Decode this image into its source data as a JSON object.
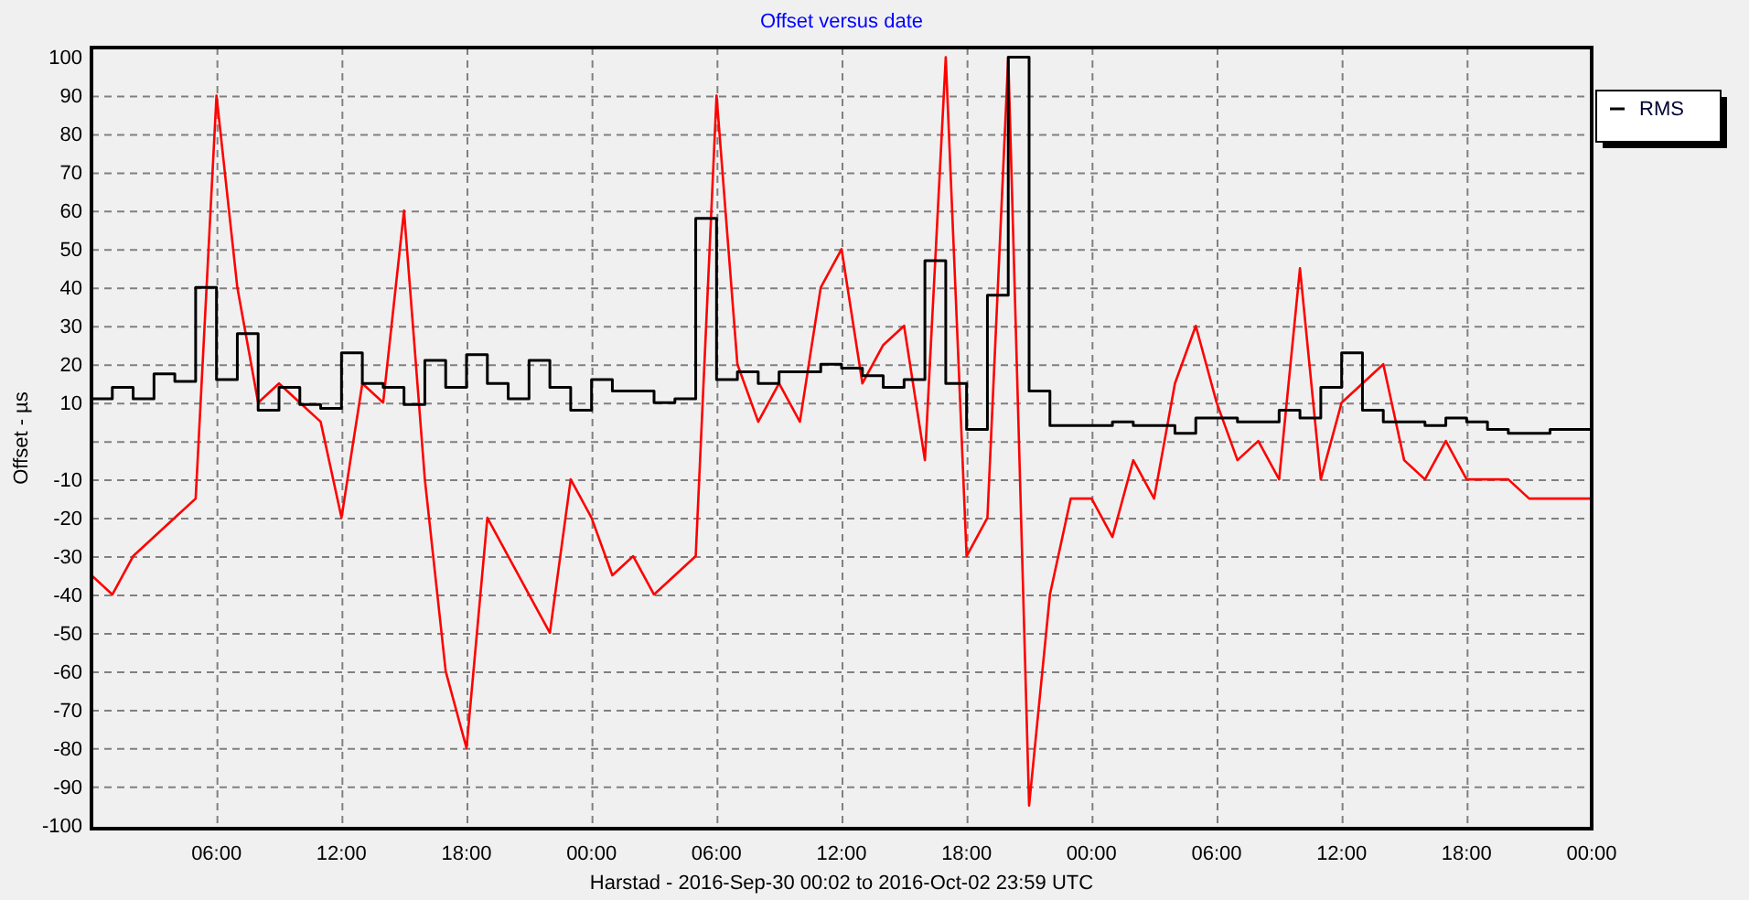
{
  "chart": {
    "chart_data": {
      "type": "line",
      "title": "Offset versus date",
      "xlabel": "Harstad  -  2016-Sep-30 00:02 to 2016-Oct-02 23:59 UTC",
      "ylabel": "Offset - µs",
      "grid": true,
      "x": [
        "2016-09-30T00:00",
        "2016-09-30T01:00",
        "2016-09-30T01:00",
        "2016-09-30T02:00",
        "2016-09-30T02:00",
        "2016-09-30T03:00",
        "2016-09-30T03:00",
        "2016-09-30T04:00",
        "2016-09-30T04:00",
        "2016-09-30T05:00",
        "2016-09-30T05:00",
        "2016-09-30T06:00",
        "2016-09-30T06:00",
        "2016-09-30T07:00",
        "2016-09-30T07:00",
        "2016-09-30T08:00",
        "2016-09-30T08:00",
        "2016-09-30T09:00",
        "2016-09-30T09:00",
        "2016-09-30T10:00",
        "2016-09-30T10:00",
        "2016-09-30T11:00",
        "2016-09-30T11:00",
        "2016-09-30T12:00",
        "2016-09-30T12:00",
        "2016-09-30T13:00",
        "2016-09-30T13:00",
        "2016-09-30T14:00",
        "2016-09-30T14:00",
        "2016-09-30T15:00",
        "2016-09-30T15:00",
        "2016-09-30T16:00",
        "2016-09-30T16:00",
        "2016-09-30T17:00",
        "2016-09-30T17:00",
        "2016-09-30T18:00",
        "2016-09-30T18:00",
        "2016-09-30T19:00",
        "2016-09-30T19:00",
        "2016-09-30T20:00",
        "2016-09-30T20:00",
        "2016-09-30T21:00",
        "2016-09-30T21:00",
        "2016-09-30T22:00",
        "2016-09-30T22:00",
        "2016-09-30T23:00",
        "2016-09-30T23:00",
        "2016-10-01T00:00",
        "2016-10-01T00:00",
        "2016-10-01T01:00",
        "2016-10-01T01:00",
        "2016-10-01T02:00",
        "2016-10-01T02:00",
        "2016-10-01T03:00",
        "2016-10-01T03:00",
        "2016-10-01T04:00",
        "2016-10-01T04:00",
        "2016-10-01T05:00",
        "2016-10-01T05:00",
        "2016-10-01T06:00",
        "2016-10-01T06:00",
        "2016-10-01T07:00",
        "2016-10-01T07:00",
        "2016-10-01T08:00",
        "2016-10-01T08:00",
        "2016-10-01T09:00",
        "2016-10-01T09:00",
        "2016-10-01T10:00",
        "2016-10-01T10:00",
        "2016-10-01T11:00",
        "2016-10-01T11:00",
        "2016-10-01T12:00",
        "2016-10-01T12:00",
        "2016-10-01T13:00",
        "2016-10-01T13:00",
        "2016-10-01T14:00",
        "2016-10-01T14:00",
        "2016-10-01T15:00",
        "2016-10-01T15:00",
        "2016-10-01T16:00",
        "2016-10-01T16:00",
        "2016-10-01T17:00",
        "2016-10-01T17:00",
        "2016-10-01T18:00",
        "2016-10-01T18:00",
        "2016-10-01T19:00",
        "2016-10-01T19:00",
        "2016-10-01T20:00",
        "2016-10-01T20:00",
        "2016-10-01T21:00",
        "2016-10-01T21:00",
        "2016-10-01T22:00",
        "2016-10-01T22:00",
        "2016-10-01T23:00",
        "2016-10-01T23:00",
        "2016-10-02T00:00",
        "2016-10-02T00:00",
        "2016-10-02T01:00",
        "2016-10-02T01:00",
        "2016-10-02T02:00",
        "2016-10-02T02:00",
        "2016-10-02T03:00",
        "2016-10-02T03:00",
        "2016-10-02T04:00",
        "2016-10-02T04:00",
        "2016-10-02T05:00",
        "2016-10-02T05:00",
        "2016-10-02T06:00",
        "2016-10-02T06:00",
        "2016-10-02T07:00",
        "2016-10-02T07:00",
        "2016-10-02T08:00",
        "2016-10-02T08:00",
        "2016-10-02T09:00",
        "2016-10-02T09:00",
        "2016-10-02T10:00",
        "2016-10-02T10:00",
        "2016-10-02T11:00",
        "2016-10-02T11:00",
        "2016-10-02T12:00",
        "2016-10-02T12:00",
        "2016-10-02T13:00",
        "2016-10-02T13:00",
        "2016-10-02T14:00",
        "2016-10-02T14:00",
        "2016-10-02T15:00",
        "2016-10-02T15:00",
        "2016-10-02T16:00",
        "2016-10-02T16:00",
        "2016-10-02T17:00",
        "2016-10-02T17:00",
        "2016-10-02T18:00",
        "2016-10-02T18:00",
        "2016-10-02T19:00",
        "2016-10-02T19:00",
        "2016-10-02T20:00",
        "2016-10-02T20:00",
        "2016-10-02T21:00",
        "2016-10-02T21:00",
        "2016-10-02T22:00",
        "2016-10-02T22:00",
        "2016-10-02T23:00",
        "2016-10-02T23:00",
        "2016-10-03T00:00",
        "2016-10-03T00:00"
      ],
      "xlim": [
        "2016-09-30T00:00",
        "2016-10-03T00:00"
      ],
      "ylim": [
        -101,
        102.5
      ],
      "xticks": [
        {
          "value": "2016-09-30T06:00",
          "label": "06:00"
        },
        {
          "value": "2016-09-30T12:00",
          "label": "12:00"
        },
        {
          "value": "2016-09-30T18:00",
          "label": "18:00"
        },
        {
          "value": "2016-10-01T00:00",
          "label": "00:00"
        },
        {
          "value": "2016-10-01T06:00",
          "label": "06:00"
        },
        {
          "value": "2016-10-01T12:00",
          "label": "12:00"
        },
        {
          "value": "2016-10-01T18:00",
          "label": "18:00"
        },
        {
          "value": "2016-10-02T00:00",
          "label": "00:00"
        },
        {
          "value": "2016-10-02T06:00",
          "label": "06:00"
        },
        {
          "value": "2016-10-02T12:00",
          "label": "12:00"
        },
        {
          "value": "2016-10-02T18:00",
          "label": "18:00"
        },
        {
          "value": "2016-10-03T00:00",
          "label": "00:00"
        }
      ],
      "yticks": [
        -100,
        -90,
        -80,
        -70,
        -60,
        -50,
        -40,
        -30,
        -20,
        -10,
        10,
        20,
        30,
        40,
        50,
        60,
        70,
        80,
        90,
        100
      ],
      "series": [
        {
          "color": "#ff0000",
          "values": [
            -35,
            -40,
            -40,
            -30,
            -30,
            -25,
            -25,
            -20,
            -20,
            -15,
            -15,
            90,
            90,
            40,
            40,
            10,
            10,
            15,
            15,
            10,
            10,
            5,
            5,
            -20,
            -20,
            15,
            15,
            10,
            10,
            60,
            60,
            -10,
            -10,
            -60,
            -60,
            -80,
            -80,
            -20,
            -20,
            -30,
            -30,
            -40,
            -40,
            -50,
            -50,
            -10,
            -10,
            -20,
            -20,
            -35,
            -35,
            -30,
            -30,
            -40,
            -40,
            -35,
            -35,
            -30,
            -30,
            90,
            90,
            20,
            20,
            5,
            5,
            15,
            15,
            5,
            5,
            40,
            40,
            50,
            50,
            15,
            15,
            25,
            25,
            30,
            30,
            -5,
            -5,
            100,
            100,
            -30,
            -30,
            -20,
            -20,
            100,
            100,
            -95,
            -95,
            -40,
            -40,
            -15,
            -15,
            -15,
            -15,
            -25,
            -25,
            -5,
            -5,
            -15,
            -15,
            15,
            15,
            30,
            30,
            10,
            10,
            -5,
            -5,
            0,
            0,
            -10,
            -10,
            45,
            45,
            -10,
            -10,
            10,
            10,
            15,
            15,
            20,
            20,
            -5,
            -5,
            -10,
            -10,
            0,
            0,
            -10,
            -10,
            -10,
            -10,
            -10,
            -10,
            -15,
            -15,
            -15,
            -15,
            -15,
            -15,
            -15,
            -15
          ]
        },
        {
          "name": "RMS",
          "color": "#000000",
          "values": [
            11,
            11,
            14,
            14,
            11,
            11,
            17.5,
            17.5,
            15.5,
            15.5,
            40,
            40,
            16,
            16,
            28,
            28,
            8,
            8,
            14,
            14,
            9.5,
            9.5,
            8.5,
            8.5,
            23,
            23,
            15,
            15,
            14,
            14,
            9.5,
            9.5,
            21,
            21,
            14,
            14,
            22.5,
            22.5,
            15,
            15,
            11,
            11,
            21,
            21,
            14,
            14,
            8,
            8,
            16,
            16,
            13,
            13,
            13,
            13,
            10,
            10,
            11,
            11,
            58,
            58,
            16,
            16,
            18,
            18,
            15,
            15,
            18,
            18,
            18,
            18,
            20,
            20,
            19,
            19,
            17,
            17,
            14,
            14,
            16,
            16,
            47,
            47,
            15,
            15,
            3,
            3,
            38,
            38,
            100,
            100,
            13,
            13,
            4,
            4,
            4,
            4,
            4,
            4,
            5,
            5,
            4,
            4,
            4,
            4,
            2,
            2,
            6,
            6,
            6,
            6,
            5,
            5,
            5,
            5,
            8,
            8,
            6,
            6,
            14,
            14,
            23,
            23,
            8,
            8,
            5,
            5,
            5,
            5,
            4,
            4,
            6,
            6,
            5,
            5,
            3,
            3,
            2,
            2,
            2,
            2,
            3,
            3,
            3,
            3,
            3
          ]
        }
      ]
    }
  }
}
